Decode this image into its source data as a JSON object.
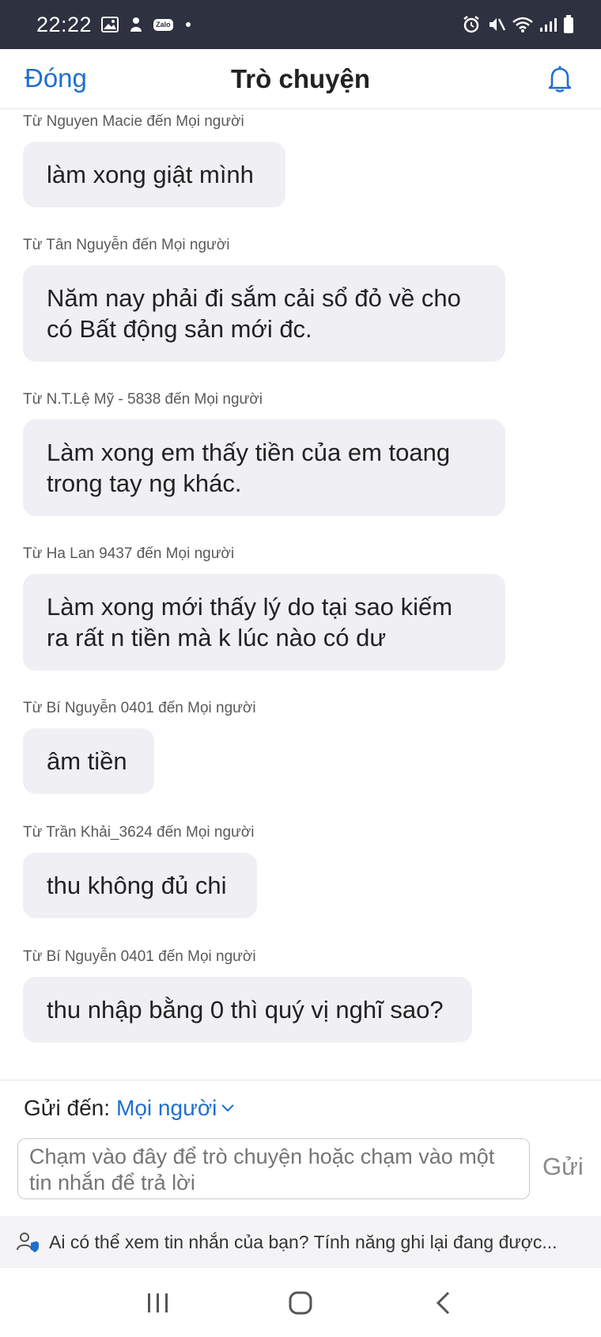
{
  "status_bar": {
    "time": "22:22",
    "zalo": "Zalo",
    "icons": [
      "gallery-icon",
      "notification-icon",
      "zalo-icon",
      "alarm-icon",
      "mute-icon",
      "wifi-icon",
      "signal-icon",
      "battery-icon"
    ]
  },
  "header": {
    "close_label": "Đóng",
    "title": "Trò chuyện"
  },
  "messages": [
    {
      "sender": "Từ Nguyen Macie đến Mọi người",
      "text": "làm xong giật mình"
    },
    {
      "sender": "Từ Tân Nguyễn đến Mọi người",
      "line1": "Năm nay phải đi sắm cải sổ đỏ về cho",
      "line2": "có Bất động sản mới đc."
    },
    {
      "sender": "Từ N.T.Lệ Mỹ - 5838 đến Mọi người",
      "line1": "Làm xong em thấy tiền của em toang",
      "line2": "trong tay ng khác."
    },
    {
      "sender": "Từ Ha Lan 9437 đến Mọi người",
      "line1": "Làm xong mới thấy lý do tại sao kiếm",
      "line2": "ra rất n tiền mà k lúc nào có dư"
    },
    {
      "sender": "Từ Bí Nguyễn 0401 đến Mọi người",
      "text": "âm tiền"
    },
    {
      "sender": "Từ Trần Khải_3624 đến Mọi người",
      "text": "thu không đủ chi"
    },
    {
      "sender": "Từ Bí Nguyễn 0401 đến Mọi người",
      "text": "thu nhập bằng 0 thì quý vị nghĩ sao?"
    }
  ],
  "send_to": {
    "label": "Gửi đến:",
    "recipient": "Mọi người"
  },
  "composer": {
    "placeholder": "Chạm vào đây để trò chuyện hoặc chạm vào một tin nhắn để trả lời",
    "send_label": "Gửi"
  },
  "notice": {
    "text": "Ai có thể xem tin nhắn của bạn? Tính năng ghi lại đang được..."
  },
  "colors": {
    "accent": "#1e6fd0",
    "status_bar": "#2e3140",
    "bubble": "#f0f0f4"
  }
}
